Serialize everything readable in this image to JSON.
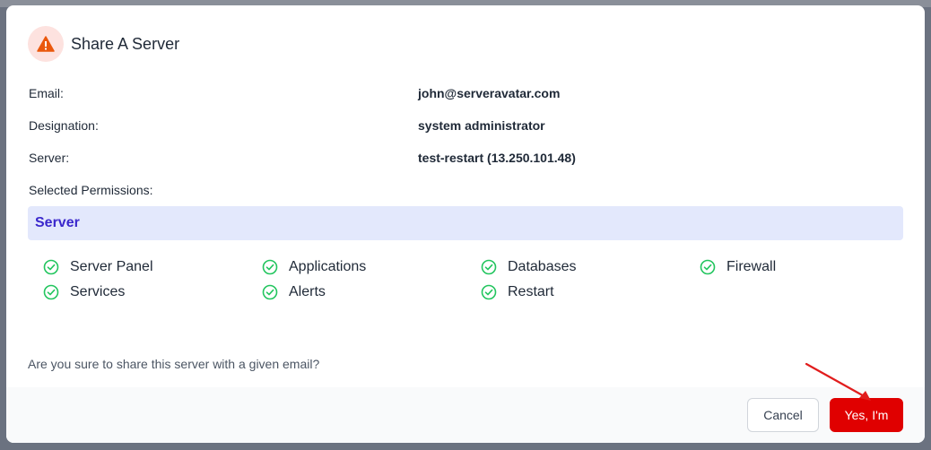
{
  "modal": {
    "title": "Share A Server",
    "fields": [
      {
        "label": "Email:",
        "value": "john@serveravatar.com"
      },
      {
        "label": "Designation:",
        "value": "system administrator"
      },
      {
        "label": "Server:",
        "value": "test-restart (13.250.101.48)"
      }
    ],
    "permissions_label": "Selected Permissions:",
    "group": {
      "name": "Server",
      "items": [
        "Server Panel",
        "Applications",
        "Databases",
        "Firewall",
        "Services",
        "Alerts",
        "Restart"
      ]
    },
    "question": "Are you sure to share this server with a given email?",
    "buttons": {
      "cancel": "Cancel",
      "confirm": "Yes, I'm"
    }
  },
  "colors": {
    "accent": "#e00000",
    "group_bg": "#e3e8fc",
    "group_text": "#3b28cc",
    "check": "#22c55e",
    "warning": "#ea580c",
    "annotation_arrow": "#e11d1d"
  },
  "icons": {
    "header": "warning-icon",
    "permission": "check-circle-icon"
  }
}
